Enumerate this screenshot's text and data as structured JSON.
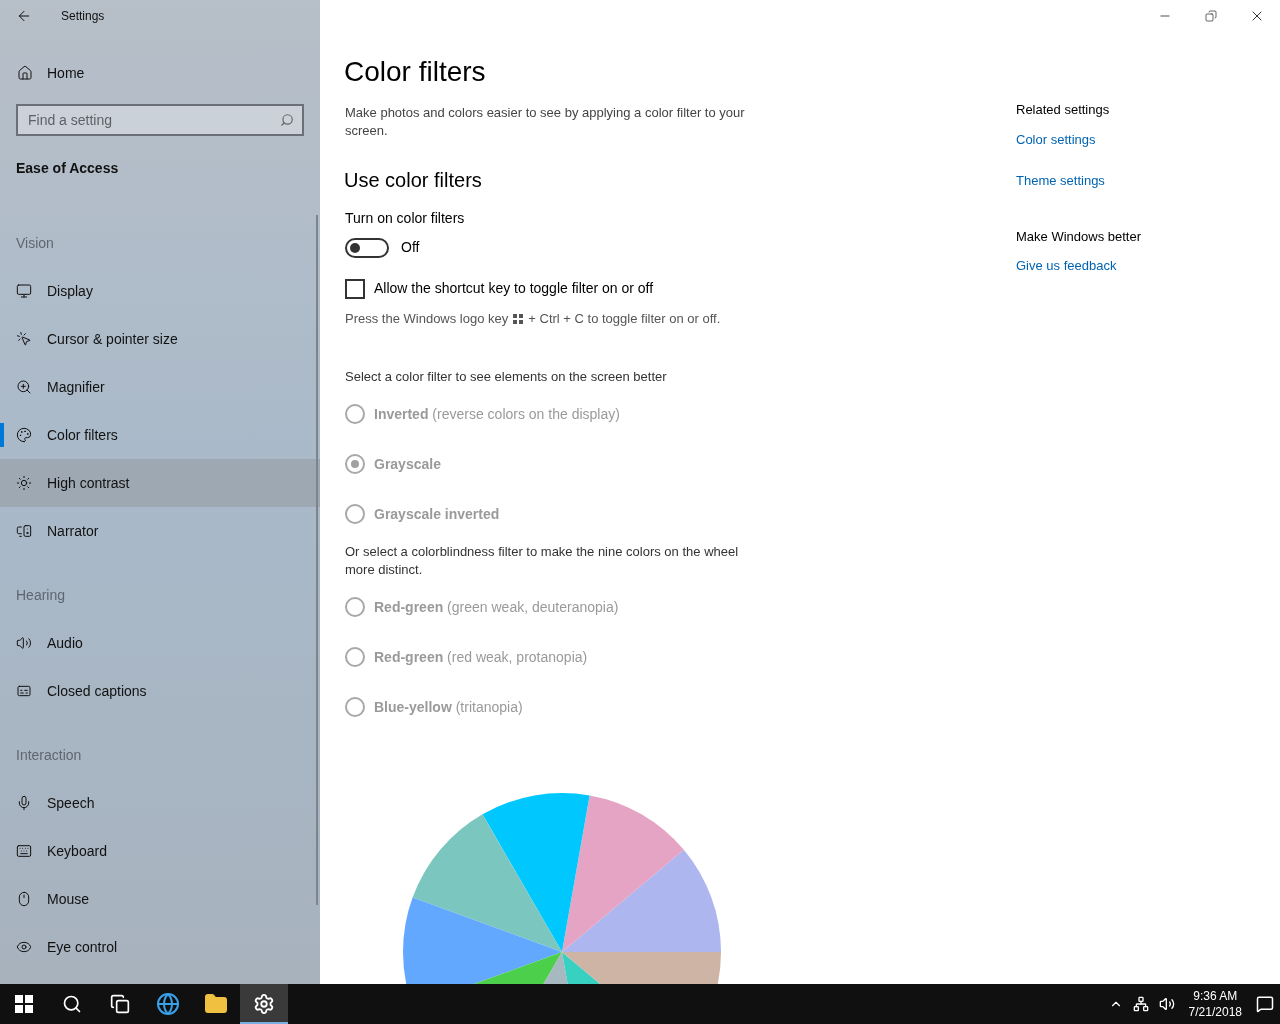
{
  "window": {
    "title": "Settings"
  },
  "sidebar": {
    "home": "Home",
    "search": {
      "placeholder": "Find a setting"
    },
    "heading": "Ease of Access",
    "groups": [
      {
        "title": "Vision",
        "items": [
          {
            "label": "Display",
            "selected": false,
            "hovered": false
          },
          {
            "label": "Cursor & pointer size",
            "selected": false,
            "hovered": false
          },
          {
            "label": "Magnifier",
            "selected": false,
            "hovered": false
          },
          {
            "label": "Color filters",
            "selected": true,
            "hovered": false
          },
          {
            "label": "High contrast",
            "selected": false,
            "hovered": true
          },
          {
            "label": "Narrator",
            "selected": false,
            "hovered": false
          }
        ]
      },
      {
        "title": "Hearing",
        "items": [
          {
            "label": "Audio",
            "selected": false,
            "hovered": false
          },
          {
            "label": "Closed captions",
            "selected": false,
            "hovered": false
          }
        ]
      },
      {
        "title": "Interaction",
        "items": [
          {
            "label": "Speech",
            "selected": false,
            "hovered": false
          },
          {
            "label": "Keyboard",
            "selected": false,
            "hovered": false
          },
          {
            "label": "Mouse",
            "selected": false,
            "hovered": false
          },
          {
            "label": "Eye control",
            "selected": false,
            "hovered": false
          }
        ]
      }
    ]
  },
  "main": {
    "title": "Color filters",
    "description": "Make photos and colors easier to see by applying a color filter to your screen.",
    "section": "Use color filters",
    "toggle": {
      "label": "Turn on color filters",
      "on": false,
      "state_text": "Off"
    },
    "checkbox": {
      "label": "Allow the shortcut key to toggle filter on or off",
      "checked": false
    },
    "hint": {
      "before": "Press the Windows logo key",
      "after": "+ Ctrl + C to toggle filter on or off."
    },
    "filter_prompt": "Select a color filter to see elements on the screen better",
    "filters": [
      {
        "label": "Inverted",
        "detail": "(reverse colors on the display)",
        "selected": false
      },
      {
        "label": "Grayscale",
        "selected": true
      },
      {
        "label": "Grayscale inverted",
        "selected": false
      }
    ],
    "colorblind_prompt": "Or select a colorblindness filter to make the nine colors on the wheel more distinct.",
    "colorblind_filters": [
      {
        "label": "Red-green",
        "detail": "(green weak, deuteranopia)",
        "selected": false
      },
      {
        "label": "Red-green",
        "detail": "(red weak, protanopia)",
        "selected": false
      },
      {
        "label": "Blue-yellow",
        "detail": "(tritanopia)",
        "selected": false
      }
    ]
  },
  "related": [
    {
      "heading": "Related settings",
      "links": [
        "Color settings",
        "Theme settings"
      ]
    },
    {
      "heading": "Make Windows better",
      "links": [
        "Give us feedback"
      ]
    }
  ],
  "taskbar": {
    "apps": [
      {
        "selected": false
      },
      {
        "selected": false
      },
      {
        "selected": false
      },
      {
        "selected": false
      },
      {
        "selected": false
      },
      {
        "selected": true
      }
    ],
    "time": "9:36 AM",
    "date": "7/21/2018"
  }
}
